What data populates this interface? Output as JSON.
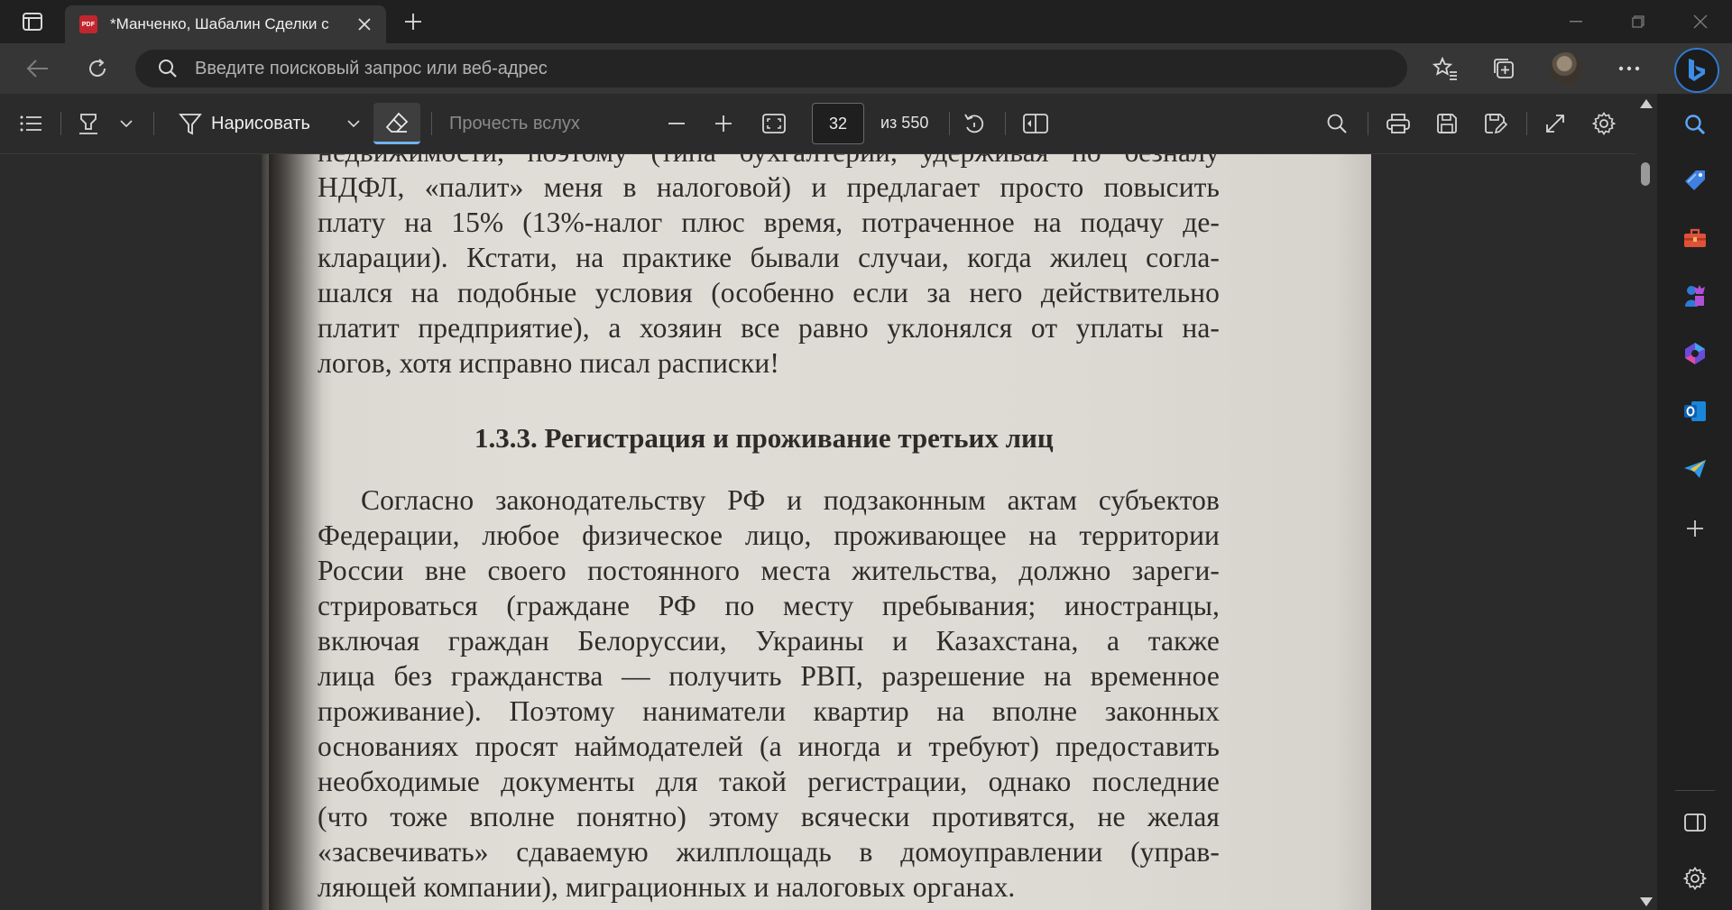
{
  "tab": {
    "file_badge": "PDF",
    "title": "*Манченко, Шабалин Сделки с"
  },
  "address_bar": {
    "placeholder": "Введите поисковый запрос или веб-адрес"
  },
  "pdf_toolbar": {
    "draw_label": "Нарисовать",
    "read_aloud_label": "Прочесть вслух",
    "page_current": "32",
    "page_total": "из 550"
  },
  "document": {
    "paragraph_top": [
      "недвижимости, поэтому (типа бухгалтерии, удерживая по безналу",
      "НДФЛ, «палит» меня в налоговой) и предлагает просто повысить",
      "плату на 15% (13%-налог плюс время, потраченное на подачу де-",
      "кларации). Кстати, на практике бывали случаи, когда жилец согла-",
      "шался на подобные условия (особенно если за него действительно",
      "платит предприятие), а хозяин все равно уклонялся от уплаты на-",
      "логов, хотя исправно писал расписки!"
    ],
    "heading": "1.3.3. Регистрация и проживание третьих лиц",
    "paragraph_main": [
      "Согласно законодательству РФ и подзаконным актам субъектов",
      "Федерации, любое физическое лицо, проживающее на территории",
      "России вне своего постоянного места жительства, должно зареги-",
      "стрироваться (граждане РФ по месту пребывания; иностранцы,",
      "включая граждан Белоруссии, Украины и Казахстана, а также",
      "лица без гражданства — получить РВП, разрешение на временное",
      "проживание). Поэтому наниматели квартир на вполне законных",
      "основаниях просят наймодателей (а иногда и требуют) предоставить",
      "необходимые документы для такой регистрации, однако последние",
      "(что тоже вполне понятно) этому всячески противятся, не желая",
      "«засвечивать» сдаваемую жилплощадь в домоуправлении (управ-",
      "ляющей компании), миграционных и налоговых органах."
    ]
  },
  "colors": {
    "accent": "#6fb3f2",
    "pdf_badge": "#c4262e",
    "page_paper": "#e0dcd6",
    "ink": "#2e2b29"
  },
  "icons": {
    "sidebar": [
      "search-icon",
      "shopping-tag-icon",
      "toolbox-icon",
      "games-icon",
      "copilot-icon",
      "outlook-icon",
      "send-icon",
      "add-icon",
      "sidebar-toggle-icon",
      "settings-icon"
    ]
  }
}
